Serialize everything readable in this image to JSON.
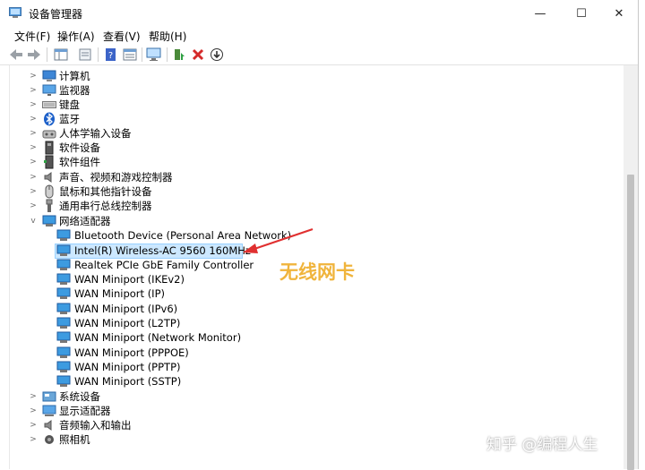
{
  "window": {
    "title": "设备管理器",
    "controls": {
      "minimize": "—",
      "maximize": "☐",
      "close": "✕"
    }
  },
  "menu": [
    "文件(F)",
    "操作(A)",
    "查看(V)",
    "帮助(H)"
  ],
  "tree": {
    "categories_top": [
      {
        "label": "计算机",
        "icon": "computer-icon"
      },
      {
        "label": "监视器",
        "icon": "monitor-icon"
      },
      {
        "label": "键盘",
        "icon": "keyboard-icon"
      },
      {
        "label": "蓝牙",
        "icon": "bluetooth-icon"
      },
      {
        "label": "人体学输入设备",
        "icon": "hid-icon"
      },
      {
        "label": "软件设备",
        "icon": "software-device-icon"
      },
      {
        "label": "软件组件",
        "icon": "software-component-icon"
      },
      {
        "label": "声音、视频和游戏控制器",
        "icon": "speaker-icon"
      },
      {
        "label": "鼠标和其他指针设备",
        "icon": "mouse-icon"
      },
      {
        "label": "通用串行总线控制器",
        "icon": "usb-icon"
      }
    ],
    "network": {
      "label": "网络适配器",
      "children": [
        "Bluetooth Device (Personal Area Network)",
        "Intel(R) Wireless-AC 9560 160MHz",
        "Realtek PCIe GbE Family Controller",
        "WAN Miniport (IKEv2)",
        "WAN Miniport (IP)",
        "WAN Miniport (IPv6)",
        "WAN Miniport (L2TP)",
        "WAN Miniport (Network Monitor)",
        "WAN Miniport (PPPOE)",
        "WAN Miniport (PPTP)",
        "WAN Miniport (SSTP)"
      ]
    },
    "categories_bottom": [
      {
        "label": "系统设备",
        "icon": "system-device-icon"
      },
      {
        "label": "显示适配器",
        "icon": "display-adapter-icon"
      },
      {
        "label": "音频输入和输出",
        "icon": "audio-icon"
      },
      {
        "label": "照相机",
        "icon": "camera-icon"
      }
    ]
  },
  "annotation": "无线网卡",
  "watermark": "知乎 @编程人生",
  "colors": {
    "selection": "#cce8ff",
    "arrow": "#e03030",
    "annotation": "#f0b43c"
  }
}
